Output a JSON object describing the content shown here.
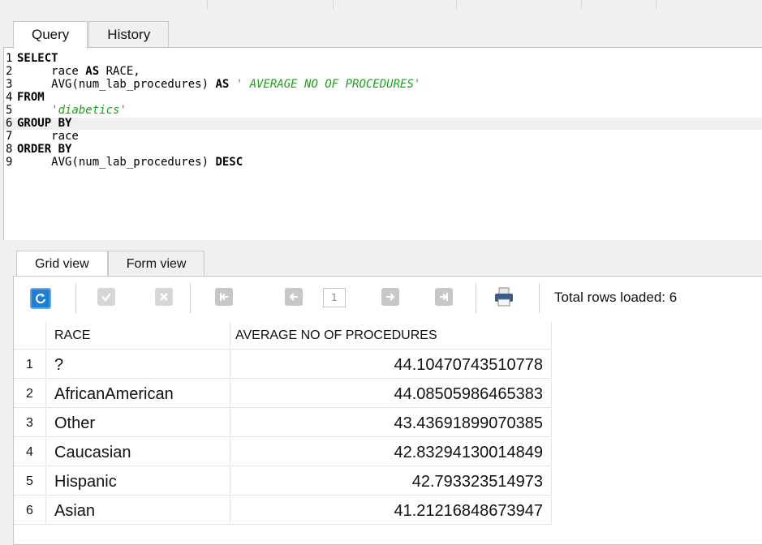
{
  "editor_tabs": [
    "Query",
    "History"
  ],
  "sql_lines": [
    {
      "n": "1",
      "parts": [
        {
          "t": "kw",
          "v": "SELECT"
        }
      ]
    },
    {
      "n": "2",
      "parts": [
        {
          "t": "plain",
          "v": "     race "
        },
        {
          "t": "kw",
          "v": "AS"
        },
        {
          "t": "plain",
          "v": " RACE,"
        }
      ]
    },
    {
      "n": "3",
      "parts": [
        {
          "t": "plain",
          "v": "     AVG(num_lab_procedures) "
        },
        {
          "t": "kw",
          "v": "AS"
        },
        {
          "t": "plain",
          "v": " "
        },
        {
          "t": "str",
          "v": "' AVERAGE NO OF PROCEDURES'"
        }
      ]
    },
    {
      "n": "4",
      "parts": [
        {
          "t": "kw",
          "v": "FROM"
        }
      ]
    },
    {
      "n": "5",
      "parts": [
        {
          "t": "plain",
          "v": "     "
        },
        {
          "t": "str",
          "v": "'diabetics'"
        }
      ]
    },
    {
      "n": "6",
      "parts": [
        {
          "t": "kw",
          "v": "GROUP BY"
        }
      ]
    },
    {
      "n": "7",
      "parts": [
        {
          "t": "plain",
          "v": "     race"
        }
      ]
    },
    {
      "n": "8",
      "parts": [
        {
          "t": "kw",
          "v": "ORDER BY"
        }
      ]
    },
    {
      "n": "9",
      "parts": [
        {
          "t": "plain",
          "v": "     AVG(num_lab_procedures) "
        },
        {
          "t": "kw",
          "v": "DESC"
        }
      ]
    }
  ],
  "result_tabs": [
    "Grid view",
    "Form view"
  ],
  "toolbar": {
    "page_number": "1",
    "total_rows_label": "Total rows loaded: 6",
    "icons": [
      "refresh-icon",
      "commit-icon",
      "rollback-icon",
      "first-page-icon",
      "prev-page-icon",
      "next-page-icon",
      "last-page-icon",
      "print-icon"
    ]
  },
  "grid": {
    "columns": [
      "RACE",
      "AVERAGE NO OF PROCEDURES"
    ],
    "rows": [
      {
        "n": "1",
        "race": "?",
        "avg": "44.10470743510778"
      },
      {
        "n": "2",
        "race": "AfricanAmerican",
        "avg": "44.08505986465383"
      },
      {
        "n": "3",
        "race": "Other",
        "avg": "43.43691899070385"
      },
      {
        "n": "4",
        "race": "Caucasian",
        "avg": "42.83294130014849"
      },
      {
        "n": "5",
        "race": "Hispanic",
        "avg": "42.793323514973"
      },
      {
        "n": "6",
        "race": "Asian",
        "avg": "41.21216848673947"
      }
    ]
  },
  "colors": {
    "accent": "#1e7fd0",
    "sql_string": "#1f9e1f"
  }
}
